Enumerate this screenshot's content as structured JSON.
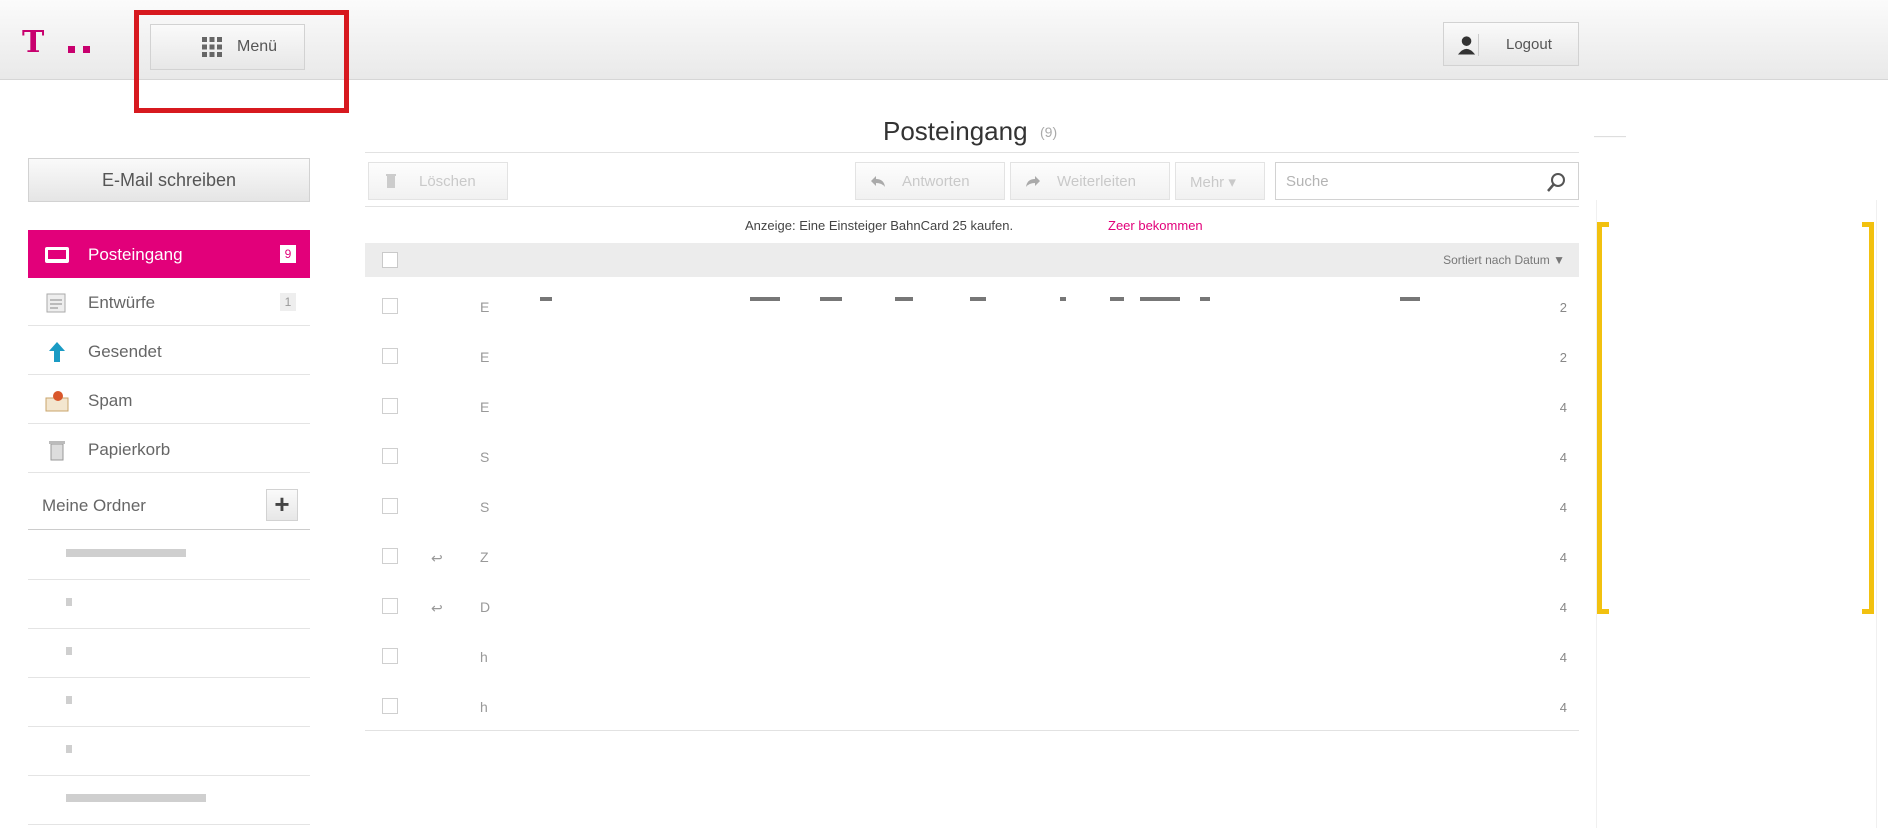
{
  "header": {
    "menu_label": "Menü",
    "logout_label": "Logout"
  },
  "sidebar": {
    "compose_label": "E-Mail schreiben",
    "folders": [
      {
        "name": "Posteingang",
        "badge": "9"
      },
      {
        "name": "Entwürfe",
        "badge": "1"
      },
      {
        "name": "Gesendet",
        "badge": ""
      },
      {
        "name": "Spam",
        "badge": ""
      },
      {
        "name": "Papierkorb",
        "badge": ""
      }
    ],
    "my_folders_label": "Meine Ordner"
  },
  "main": {
    "title": "Posteingang",
    "count": "(9)",
    "toolbar": {
      "delete_label": "Löschen",
      "reply_label": "Antworten",
      "forward_label": "Weiterleiten",
      "more_label": "Mehr ▾",
      "search_placeholder": "Suche"
    },
    "ad_text": "Anzeige: Eine Einsteiger BahnCard 25 kaufen.",
    "ad_link": "Zeer bekommen",
    "sort_label": "Sortiert nach Datum ▼",
    "rows": [
      {
        "sender": "E",
        "date": "2",
        "replied": false
      },
      {
        "sender": "E",
        "date": "2",
        "replied": false
      },
      {
        "sender": "E",
        "date": "4",
        "replied": false
      },
      {
        "sender": "S",
        "date": "4",
        "replied": false
      },
      {
        "sender": "S",
        "date": "4",
        "replied": false
      },
      {
        "sender": "Z",
        "date": "4",
        "replied": true
      },
      {
        "sender": "D",
        "date": "4",
        "replied": true
      },
      {
        "sender": "h",
        "date": "4",
        "replied": false
      },
      {
        "sender": "h",
        "date": "4",
        "replied": false
      }
    ]
  },
  "colors": {
    "brand": "#e2007a",
    "highlight_box": "#d7191f",
    "bracket": "#f2c10f"
  },
  "icons": {
    "menu": "grid-icon",
    "logout": "user-icon",
    "search": "magnifier-icon"
  }
}
